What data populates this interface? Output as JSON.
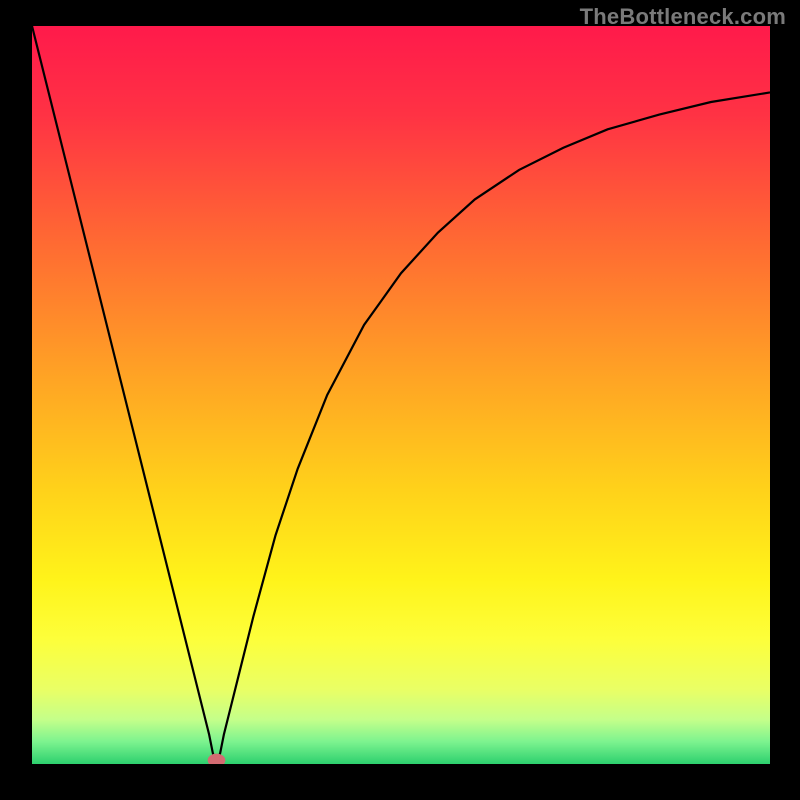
{
  "watermark": "TheBottleneck.com",
  "chart_data": {
    "type": "line",
    "title": "",
    "xlabel": "",
    "ylabel": "",
    "xlim": [
      0,
      100
    ],
    "ylim": [
      0,
      100
    ],
    "grid": false,
    "legend": false,
    "gradient_stops": [
      {
        "offset": 0,
        "color": "#ff1a4b"
      },
      {
        "offset": 12,
        "color": "#ff3244"
      },
      {
        "offset": 30,
        "color": "#ff6c32"
      },
      {
        "offset": 48,
        "color": "#ffa524"
      },
      {
        "offset": 63,
        "color": "#ffd21a"
      },
      {
        "offset": 75,
        "color": "#fff31a"
      },
      {
        "offset": 83,
        "color": "#fdff3a"
      },
      {
        "offset": 90,
        "color": "#e9ff66"
      },
      {
        "offset": 94,
        "color": "#c4ff8a"
      },
      {
        "offset": 97,
        "color": "#7cf38f"
      },
      {
        "offset": 100,
        "color": "#2dd06e"
      }
    ],
    "series": [
      {
        "name": "curve",
        "color": "#000000",
        "x": [
          0,
          4,
          8,
          12,
          16,
          20,
          23,
          24,
          24.5,
          25,
          25.5,
          26,
          27,
          28,
          30,
          33,
          36,
          40,
          45,
          50,
          55,
          60,
          66,
          72,
          78,
          85,
          92,
          100
        ],
        "y": [
          100,
          84,
          68,
          52,
          36,
          20,
          8,
          4,
          1.5,
          0,
          1.5,
          4,
          8,
          12,
          20,
          31,
          40,
          50,
          59.5,
          66.5,
          72,
          76.5,
          80.5,
          83.5,
          86,
          88,
          89.7,
          91
        ]
      }
    ],
    "marker": {
      "x": 25,
      "y": 0.5,
      "rx": 1.2,
      "ry": 0.9,
      "color": "#d46b72"
    }
  }
}
